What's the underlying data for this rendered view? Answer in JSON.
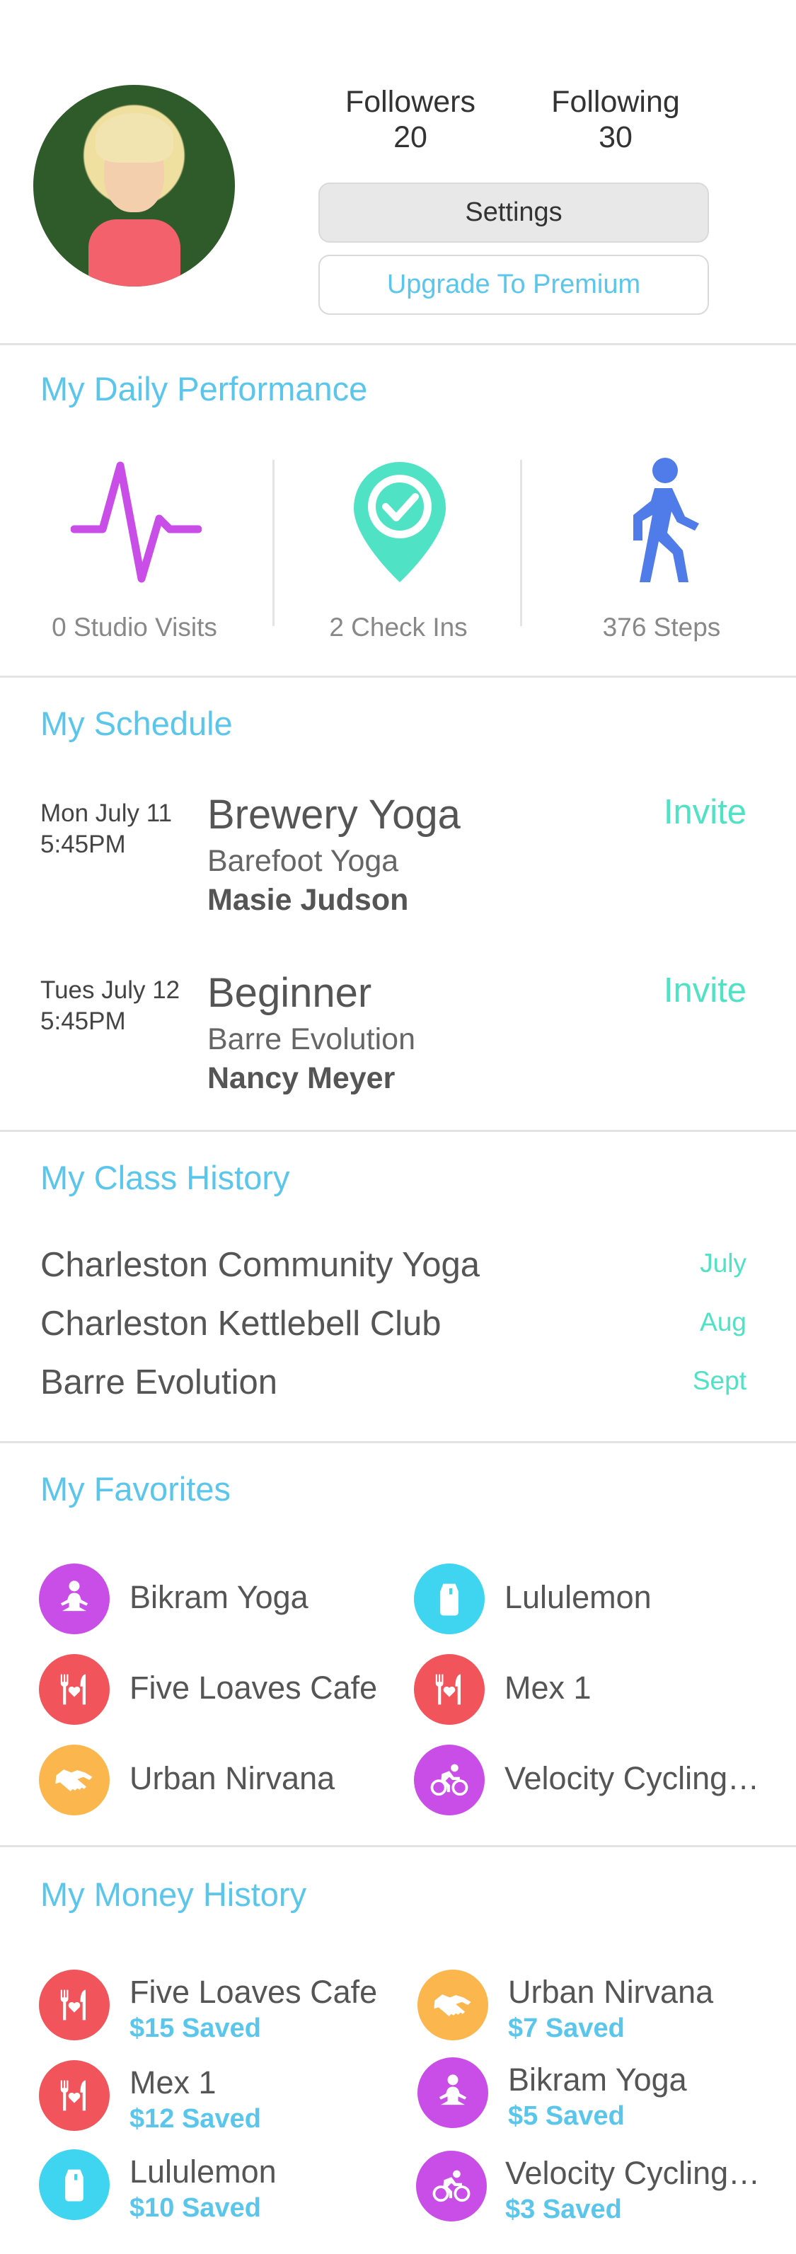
{
  "profile": {
    "followers_label": "Followers",
    "followers_count": "20",
    "following_label": "Following",
    "following_count": "30",
    "settings_label": "Settings",
    "premium_label": "Upgrade To Premium"
  },
  "performance": {
    "title": "My Daily Performance",
    "items": [
      {
        "icon": "heartbeat-icon",
        "label": "0 Studio Visits",
        "color": "#c94ee8"
      },
      {
        "icon": "check-in-pin-icon",
        "label": "2 Check Ins",
        "color": "#4fe2c4"
      },
      {
        "icon": "walking-icon",
        "label": "376 Steps",
        "color": "#4f7ce8"
      }
    ]
  },
  "schedule": {
    "title": "My Schedule",
    "items": [
      {
        "date": "Mon July 11\n5:45PM",
        "class": "Brewery Yoga",
        "studio": "Barefoot Yoga",
        "instructor": "Masie Judson",
        "invite": "Invite"
      },
      {
        "date": "Tues July 12\n5:45PM",
        "class": "Beginner",
        "studio": "Barre Evolution",
        "instructor": "Nancy Meyer",
        "invite": "Invite"
      }
    ]
  },
  "class_history": {
    "title": "My Class History",
    "items": [
      {
        "name": "Charleston Community Yoga",
        "month": "July"
      },
      {
        "name": "Charleston Kettlebell Club",
        "month": "Aug"
      },
      {
        "name": "Barre Evolution",
        "month": "Sept"
      }
    ]
  },
  "favorites": {
    "title": "My Favorites",
    "items": [
      {
        "name": "Bikram Yoga",
        "icon": "meditation-icon",
        "color": "#c94ee8"
      },
      {
        "name": "Lululemon",
        "icon": "bottle-icon",
        "color": "#3fd4f0"
      },
      {
        "name": "Five Loaves Cafe",
        "icon": "restaurant-icon",
        "color": "#f2545b"
      },
      {
        "name": "Mex 1",
        "icon": "restaurant-icon",
        "color": "#f2545b"
      },
      {
        "name": "Urban Nirvana",
        "icon": "handshake-icon",
        "color": "#fbb64e"
      },
      {
        "name": "Velocity Cycling…",
        "icon": "cycling-icon",
        "color": "#c94ee8"
      }
    ]
  },
  "money_history": {
    "title": "My Money History",
    "items": [
      {
        "name": "Five Loaves Cafe",
        "saved": "$15 Saved",
        "icon": "restaurant-icon",
        "color": "#f2545b"
      },
      {
        "name": "Urban Nirvana",
        "saved": "$7 Saved",
        "icon": "handshake-icon",
        "color": "#fbb64e"
      },
      {
        "name": "Mex 1",
        "saved": "$12 Saved",
        "icon": "restaurant-icon",
        "color": "#f2545b"
      },
      {
        "name": "Bikram Yoga",
        "saved": "$5 Saved",
        "icon": "meditation-icon",
        "color": "#c94ee8"
      },
      {
        "name": "Lululemon",
        "saved": "$10 Saved",
        "icon": "bottle-icon",
        "color": "#3fd4f0"
      },
      {
        "name": "Velocity Cycling…",
        "saved": "$3 Saved",
        "icon": "cycling-icon",
        "color": "#c94ee8"
      }
    ]
  }
}
